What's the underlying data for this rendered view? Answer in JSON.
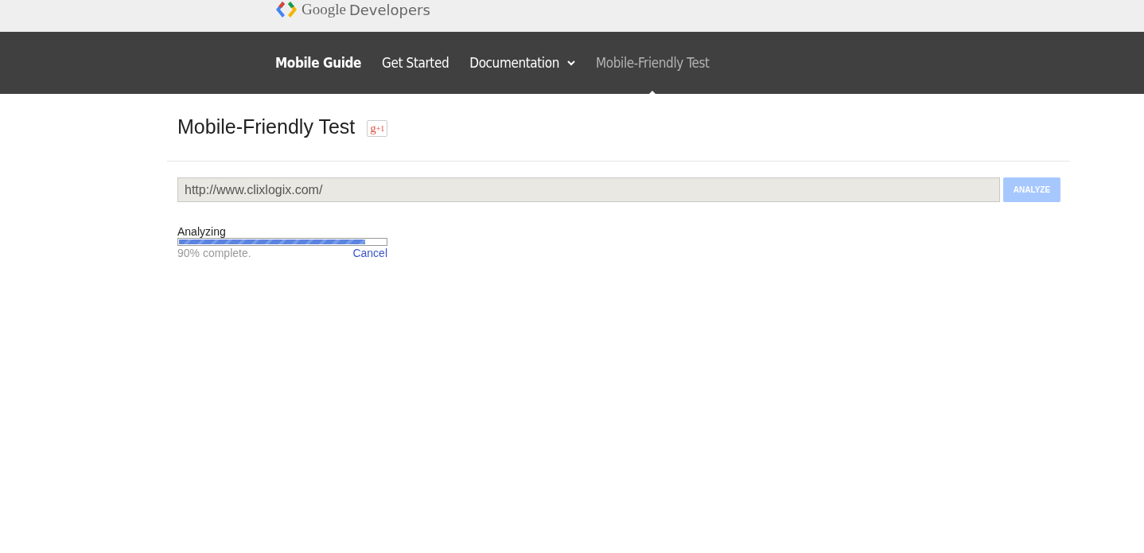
{
  "header": {
    "logo_text": "Google",
    "logo_suffix": "Developers"
  },
  "nav": [
    {
      "label": "Mobile Guide",
      "kind": "brand",
      "selected": false
    },
    {
      "label": "Get Started",
      "kind": "link",
      "selected": false
    },
    {
      "label": "Documentation",
      "kind": "dropdown",
      "selected": false
    },
    {
      "label": "Mobile-Friendly Test",
      "kind": "link",
      "selected": true
    }
  ],
  "page": {
    "title": "Mobile-Friendly Test",
    "plus_one": "+1",
    "plus_g": "g"
  },
  "form": {
    "url": "http://www.clixlogix.com/",
    "button": "ANALYZE",
    "button_disabled": true
  },
  "progress": {
    "label": "Analyzing",
    "level": 0.9,
    "status": "90% complete.",
    "cancel": "Cancel"
  }
}
